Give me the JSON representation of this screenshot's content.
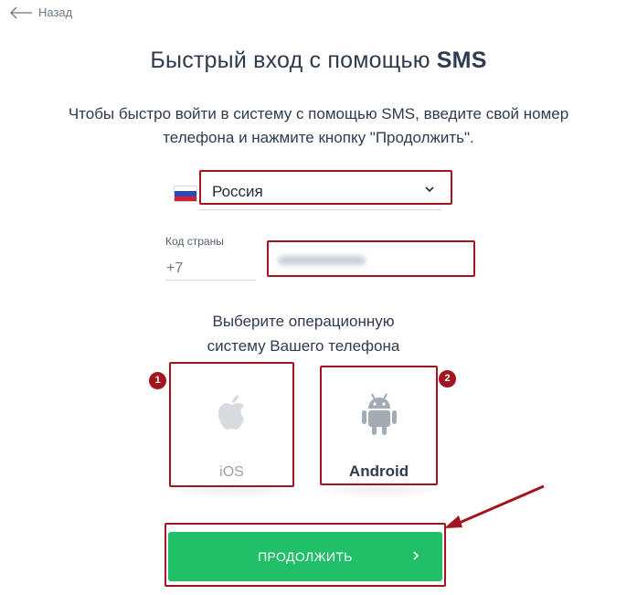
{
  "back": {
    "label": "Назад"
  },
  "page": {
    "title_plain": "Быстрый вход с помощью ",
    "title_bold": "SMS",
    "subtitle_line1": "Чтобы быстро войти в систему с помощью SMS, введите свой номер",
    "subtitle_line2": "телефона и нажмите кнопку \"Продолжить\"."
  },
  "country": {
    "selected": "Россия",
    "flag_colors": [
      "#ffffff",
      "#2c49b5",
      "#d32030"
    ]
  },
  "phone": {
    "code_label": "Код страны",
    "code_value": "+7",
    "number_value": ""
  },
  "os": {
    "prompt_line1": "Выберите операционную",
    "prompt_line2": "систему Вашего телефона",
    "options": [
      {
        "label": "iOS",
        "icon": "apple-icon",
        "badge": "1"
      },
      {
        "label": "Android",
        "icon": "android-icon",
        "badge": "2"
      }
    ]
  },
  "continue": {
    "label": "ПРОДОЛЖИТЬ",
    "icon": "chevron-right-icon"
  },
  "colors": {
    "accent_green": "#21c068",
    "highlight_red": "#a3151e",
    "text": "#2f3b4f"
  }
}
